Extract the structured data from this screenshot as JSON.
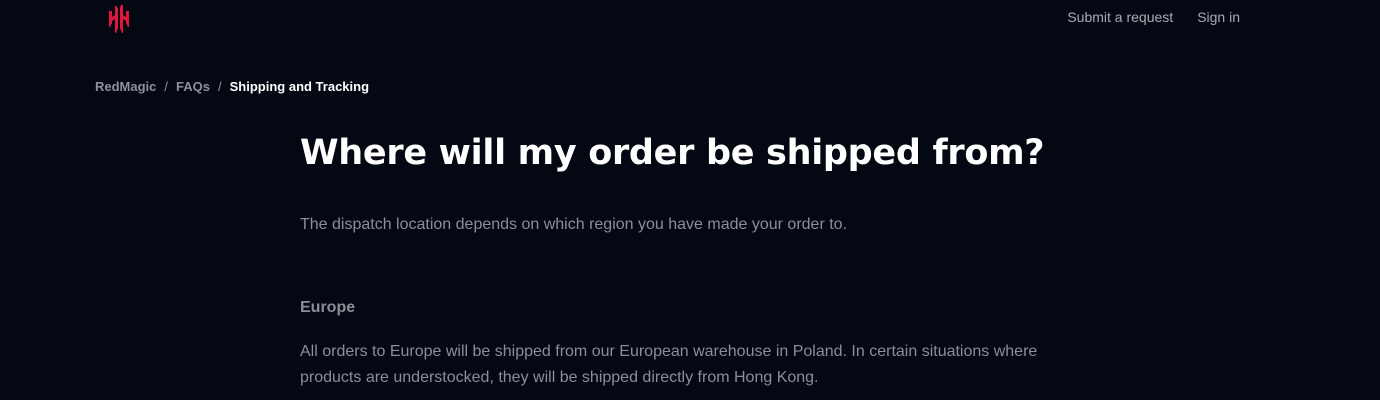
{
  "header": {
    "logo_name": "redmagic-logo-icon",
    "nav": {
      "submit_request": "Submit a request",
      "sign_in": "Sign in"
    }
  },
  "breadcrumb": {
    "items": [
      "RedMagic",
      "FAQs",
      "Shipping and Tracking"
    ],
    "separator": "/"
  },
  "article": {
    "title": "Where will my order be shipped from?",
    "intro": "The dispatch location depends on which region you have made your order to.",
    "sections": [
      {
        "heading": "Europe",
        "body": "All orders to Europe will be shipped from our European warehouse in Poland. In certain situations where products are understocked, they will be shipped directly from Hong Kong."
      }
    ]
  },
  "colors": {
    "background": "#040813",
    "brand_red": "#e0163a",
    "text_muted": "#8a8e97",
    "text_primary": "#ffffff"
  }
}
